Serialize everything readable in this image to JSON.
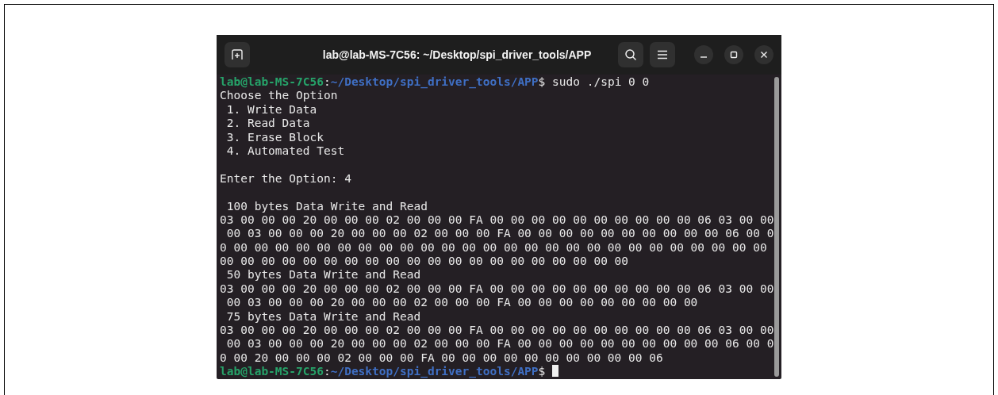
{
  "window": {
    "title": "lab@lab-MS-7C56: ~/Desktop/spi_driver_tools/APP"
  },
  "terminal": {
    "lines": [
      {
        "kind": "prompt",
        "user": "lab@lab-MS-7C56",
        "separator": ":",
        "path": "~/Desktop/spi_driver_tools/APP",
        "symbol": "$",
        "command": " sudo ./spi 0 0",
        "cursor": false
      },
      {
        "kind": "output",
        "text": "Choose the Option"
      },
      {
        "kind": "output",
        "text": " 1. Write Data"
      },
      {
        "kind": "output",
        "text": " 2. Read Data"
      },
      {
        "kind": "output",
        "text": " 3. Erase Block"
      },
      {
        "kind": "output",
        "text": " 4. Automated Test"
      },
      {
        "kind": "blank"
      },
      {
        "kind": "output",
        "text": "Enter the Option: 4"
      },
      {
        "kind": "blank"
      },
      {
        "kind": "output",
        "text": " 100 bytes Data Write and Read"
      },
      {
        "kind": "output",
        "text": "03 00 00 00 20 00 00 00 02 00 00 00 FA 00 00 00 00 00 00 00 00 00 00 06 03 00 00"
      },
      {
        "kind": "output",
        "text": " 00 03 00 00 00 20 00 00 00 02 00 00 00 FA 00 00 00 00 00 00 00 00 00 00 06 00 0"
      },
      {
        "kind": "output",
        "text": "0 00 00 00 00 00 00 00 00 00 00 00 00 00 00 00 00 00 00 00 00 00 00 00 00 00 00"
      },
      {
        "kind": "output",
        "text": "00 00 00 00 00 00 00 00 00 00 00 00 00 00 00 00 00 00 00 00"
      },
      {
        "kind": "output",
        "text": " 50 bytes Data Write and Read"
      },
      {
        "kind": "output",
        "text": "03 00 00 00 20 00 00 00 02 00 00 00 FA 00 00 00 00 00 00 00 00 00 00 06 03 00 00"
      },
      {
        "kind": "output",
        "text": " 00 03 00 00 00 20 00 00 00 02 00 00 00 FA 00 00 00 00 00 00 00 00 00"
      },
      {
        "kind": "output",
        "text": " 75 bytes Data Write and Read"
      },
      {
        "kind": "output",
        "text": "03 00 00 00 20 00 00 00 02 00 00 00 FA 00 00 00 00 00 00 00 00 00 00 06 03 00 00"
      },
      {
        "kind": "output",
        "text": " 00 03 00 00 00 20 00 00 00 02 00 00 00 FA 00 00 00 00 00 00 00 00 00 00 06 00 0"
      },
      {
        "kind": "output",
        "text": "0 00 20 00 00 00 02 00 00 00 FA 00 00 00 00 00 00 00 00 00 00 06"
      },
      {
        "kind": "prompt",
        "user": "lab@lab-MS-7C56",
        "separator": ":",
        "path": "~/Desktop/spi_driver_tools/APP",
        "symbol": "$",
        "cursor": true
      }
    ]
  }
}
